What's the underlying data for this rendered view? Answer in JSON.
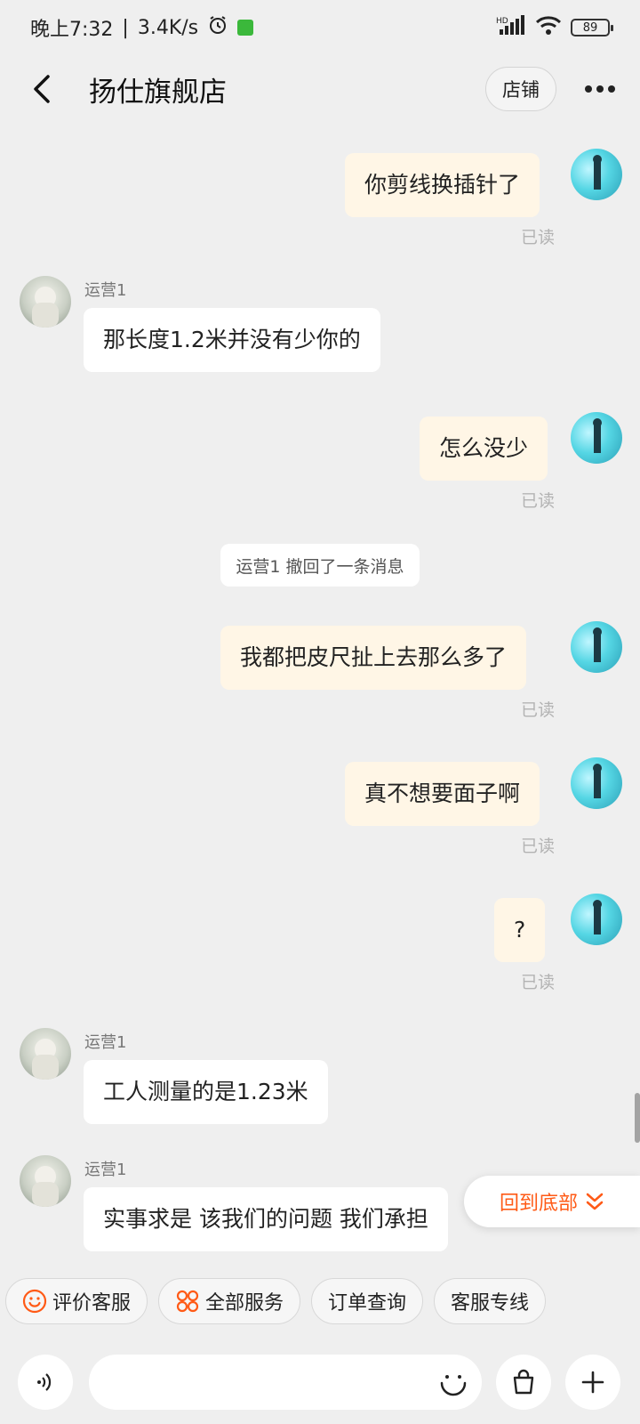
{
  "status_bar": {
    "time": "晚上7:32",
    "speed": "3.4K/s",
    "network": "HD",
    "battery": "89"
  },
  "header": {
    "title": "扬仕旗舰店",
    "store_label": "店铺"
  },
  "chat": {
    "read_label": "已读",
    "messages": [
      {
        "from": "me",
        "text": "你剪线换插针了"
      },
      {
        "from": "shop",
        "sender": "运营1",
        "text": "那长度1.2米并没有少你的"
      },
      {
        "from": "me",
        "text": "怎么没少"
      },
      {
        "from": "system",
        "text": "运营1 撤回了一条消息"
      },
      {
        "from": "me",
        "text": "我都把皮尺扯上去那么多了"
      },
      {
        "from": "me",
        "text": "真不想要面子啊"
      },
      {
        "from": "me",
        "text": "?"
      },
      {
        "from": "shop",
        "sender": "运营1",
        "text": "工人测量的是1.23米"
      },
      {
        "from": "shop",
        "sender": "运营1",
        "text": "实事求是 该我们的问题 我们承担"
      }
    ]
  },
  "back_to_bottom": {
    "label": "回到底部"
  },
  "quick_actions": [
    {
      "label": "评价客服",
      "icon": "smile-icon"
    },
    {
      "label": "全部服务",
      "icon": "grid-icon"
    },
    {
      "label": "订单查询",
      "icon": ""
    },
    {
      "label": "客服专线",
      "icon": ""
    }
  ],
  "input": {
    "placeholder": ""
  },
  "colors": {
    "accent": "#ff5a16",
    "my_bubble": "#fff6e6",
    "background": "#efefef"
  }
}
